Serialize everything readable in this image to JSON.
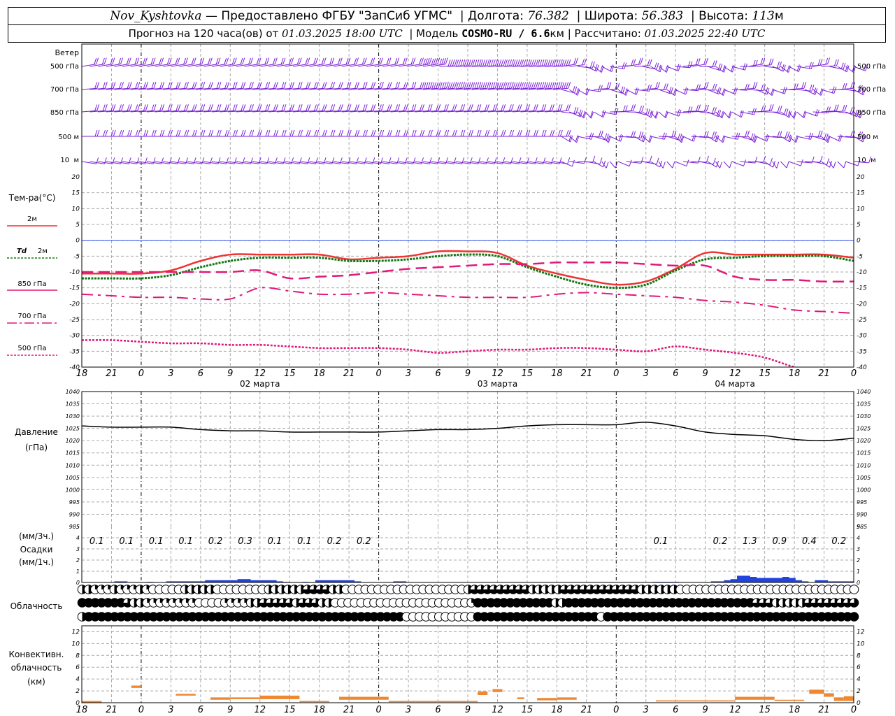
{
  "header": {
    "station": "Nov_Kyshtovka",
    "provider": "— Предоставлено ФГБУ \"ЗапСиб УГМС\"",
    "lon_label": "Долгота:",
    "lon": "76.382",
    "lat_label": "Широта:",
    "lat": "56.383",
    "alt_label": "Высота:",
    "alt": "113",
    "alt_unit": "м",
    "forecast_label": "Прогноз на 120 часа(ов) от",
    "forecast_from": "01.03.2025 18:00 UTC",
    "model_label": "| Модель",
    "model": "COSMO-RU / 6.6",
    "model_unit": "км",
    "calc_label": "| Рассчитано:",
    "calc": "01.03.2025 22:40 UTC"
  },
  "time_axis": {
    "tick_labels": [
      "18",
      "21",
      "0",
      "3",
      "6",
      "9",
      "12",
      "15",
      "18",
      "21",
      "0",
      "3",
      "6",
      "9",
      "12",
      "15",
      "18",
      "21",
      "0",
      "3",
      "6",
      "9",
      "12",
      "15",
      "18",
      "21",
      "0"
    ],
    "date_labels": [
      "02 марта",
      "03 марта",
      "04 марта"
    ],
    "hours_from_start": [
      0,
      3,
      6,
      9,
      12,
      15,
      18,
      21,
      24,
      27,
      30,
      33,
      36,
      39,
      42,
      45,
      48,
      51,
      54,
      57,
      60,
      63,
      66,
      69,
      72,
      75,
      78
    ],
    "day_boundaries_hours": [
      6,
      30,
      54
    ]
  },
  "colors": {
    "wind": "#7a1fd6",
    "t2m": "#ee3333",
    "td2m": "#117711",
    "t850": "#e0187a",
    "t700": "#e0187a",
    "t500": "#e0187a",
    "zero_line": "#3355ee",
    "pressure": "#000000",
    "precip": "#2244dd",
    "convective": "#ee8833"
  },
  "wind_panel": {
    "title": "Ветер",
    "levels": [
      "500 гПа",
      "700 гПа",
      "850 гПа",
      "500 м",
      "10  м"
    ]
  },
  "temp_legend": {
    "title": "Тем-ра(°C)",
    "t2m": "2м",
    "td_symbol": "Td",
    "td_level": "2м",
    "t850": "850 гПа",
    "t700": "700 гПа",
    "t500": "500 гПа"
  },
  "pressure_legend": {
    "title": "Давление",
    "unit": "(гПа)"
  },
  "precip_legend": {
    "unit3h": "(мм/3ч.)",
    "title": "Осадки",
    "unit1h": "(мм/1ч.)"
  },
  "cloud_legend": {
    "title": "Облачность"
  },
  "conv_legend": {
    "line1": "Конвективн.",
    "line2": "облачность",
    "unit": "(км)"
  },
  "chart_data": [
    {
      "type": "line",
      "title": "Тем-ра(°C)",
      "x_unit": "hours from 01.03.2025 18:00 UTC",
      "ylim": [
        -40,
        20
      ],
      "yticks": [
        20,
        15,
        10,
        5,
        0,
        -5,
        -10,
        -15,
        -20,
        -25,
        -30,
        -35,
        -40
      ],
      "grid": true,
      "x": [
        0,
        3,
        6,
        9,
        12,
        15,
        18,
        21,
        24,
        27,
        30,
        33,
        36,
        39,
        42,
        45,
        48,
        51,
        54,
        57,
        60,
        63,
        66,
        69,
        72,
        75,
        78
      ],
      "series": [
        {
          "name": "2м",
          "values": [
            -10.5,
            -10.5,
            -10.5,
            -9.5,
            -6.5,
            -4.5,
            -4.5,
            -4.5,
            -4.5,
            -6,
            -5.5,
            -5,
            -3.5,
            -3.5,
            -4,
            -8,
            -10.5,
            -12.5,
            -14,
            -13,
            -9,
            -4,
            -4.5,
            -4.5,
            -4.5,
            -4.5,
            -5.5
          ]
        },
        {
          "name": "Td 2м",
          "values": [
            -12,
            -12,
            -12,
            -11,
            -8.5,
            -6.5,
            -5.5,
            -5.5,
            -5.5,
            -6.5,
            -6.5,
            -6,
            -5,
            -4.5,
            -5,
            -8.5,
            -11.5,
            -14,
            -15,
            -14,
            -9.5,
            -6,
            -5.5,
            -5,
            -5,
            -5,
            -6.5
          ]
        },
        {
          "name": "850 гПа",
          "values": [
            -10,
            -10,
            -10,
            -10,
            -10,
            -10,
            -9.5,
            -12,
            -11.5,
            -11,
            -10,
            -9,
            -8.5,
            -8,
            -7.5,
            -7.5,
            -7,
            -7,
            -7,
            -7.5,
            -8,
            -8,
            -11.5,
            -12.5,
            -12.5,
            -13,
            -13
          ]
        },
        {
          "name": "700 гПа",
          "values": [
            -17,
            -17.5,
            -18,
            -18,
            -18.5,
            -18.5,
            -15,
            -16,
            -17,
            -17,
            -16.5,
            -17,
            -17.5,
            -18,
            -18,
            -18,
            -17,
            -16.5,
            -17,
            -17.5,
            -18,
            -19,
            -19.5,
            -20.5,
            -22,
            -22.5,
            -23
          ]
        },
        {
          "name": "500 гПа",
          "values": [
            -31.5,
            -31.5,
            -32,
            -32.5,
            -32.5,
            -33,
            -33,
            -33.5,
            -34,
            -34,
            -34,
            -34.5,
            -35.5,
            -35,
            -34.5,
            -34.5,
            -34,
            -34,
            -34.5,
            -35,
            -33.5,
            -34.5,
            -35.5,
            -37,
            -40,
            -42,
            -44
          ]
        }
      ]
    },
    {
      "type": "line",
      "title": "Давление",
      "ylim": [
        985,
        1040
      ],
      "yticks": [
        1040,
        1035,
        1030,
        1025,
        1020,
        1015,
        1010,
        1005,
        1000,
        995,
        990,
        985
      ],
      "grid": true,
      "x": [
        0,
        3,
        6,
        9,
        12,
        15,
        18,
        21,
        24,
        27,
        30,
        33,
        36,
        39,
        42,
        45,
        48,
        51,
        54,
        57,
        60,
        63,
        66,
        69,
        72,
        75,
        78
      ],
      "series": [
        {
          "name": "",
          "values": [
            1026,
            1025.5,
            1025.5,
            1025.5,
            1024.5,
            1024,
            1024,
            1023.5,
            1023.5,
            1023.5,
            1023.5,
            1024,
            1024.5,
            1024.5,
            1025,
            1026,
            1026.5,
            1026.5,
            1026.5,
            1027.5,
            1026,
            1023.5,
            1022.5,
            1022,
            1020.5,
            1020,
            1021
          ]
        }
      ]
    },
    {
      "type": "bar",
      "title": "Осадки",
      "ylim": [
        0,
        5
      ],
      "yticks": [
        5,
        4,
        3,
        2,
        1,
        0
      ],
      "three_hour_totals": [
        {
          "hour": 1.5,
          "label": "0.1"
        },
        {
          "hour": 4.5,
          "label": "0.1"
        },
        {
          "hour": 7.5,
          "label": "0.1"
        },
        {
          "hour": 10.5,
          "label": "0.1"
        },
        {
          "hour": 13.5,
          "label": "0.2"
        },
        {
          "hour": 16.5,
          "label": "0.3"
        },
        {
          "hour": 19.5,
          "label": "0.1"
        },
        {
          "hour": 22.5,
          "label": "0.1"
        },
        {
          "hour": 25.5,
          "label": "0.2"
        },
        {
          "hour": 28.5,
          "label": "0.2"
        },
        {
          "hour": 58.5,
          "label": "0.1"
        },
        {
          "hour": 64.5,
          "label": "0.2"
        },
        {
          "hour": 67.5,
          "label": "1.3"
        },
        {
          "hour": 70.5,
          "label": "0.9"
        },
        {
          "hour": 73.5,
          "label": "0.4"
        },
        {
          "hour": 76.5,
          "label": "0.2"
        }
      ],
      "hourly_values_mm": [
        0,
        0,
        0,
        0,
        0,
        0.1,
        0.1,
        0,
        0,
        0,
        0.05,
        0,
        0,
        0.1,
        0.1,
        0.1,
        0.1,
        0.1,
        0.1,
        0.2,
        0.2,
        0.2,
        0.2,
        0.2,
        0.3,
        0.3,
        0.2,
        0.2,
        0.2,
        0.2,
        0.1,
        0.05,
        0,
        0,
        0.05,
        0,
        0.2,
        0.2,
        0.2,
        0.2,
        0.2,
        0.2,
        0.1,
        0,
        0,
        0,
        0,
        0,
        0.1,
        0.1,
        0,
        0,
        0,
        0,
        0,
        0,
        0,
        0,
        0,
        0,
        0,
        0,
        0,
        0,
        0,
        0,
        0,
        0,
        0,
        0,
        0,
        0,
        0,
        0,
        0,
        0,
        0,
        0,
        0,
        0,
        0,
        0,
        0,
        0,
        0,
        0,
        0,
        0,
        0.05,
        0.05,
        0.05,
        0.05,
        0,
        0,
        0,
        0,
        0,
        0.1,
        0.1,
        0.2,
        0.3,
        0.6,
        0.6,
        0.5,
        0.4,
        0.4,
        0.4,
        0.4,
        0.5,
        0.4,
        0.2,
        0.1,
        0,
        0.2,
        0.2,
        0.1,
        0.1,
        0.1,
        0.1
      ]
    },
    {
      "type": "table",
      "title": "Облачность",
      "rows_eighths": {
        "high": [
          4,
          4,
          2,
          2,
          2,
          4,
          2,
          2,
          2,
          4,
          2,
          0,
          0,
          0,
          0,
          0,
          4,
          4,
          4,
          4,
          4,
          0,
          0,
          0,
          0,
          0,
          0,
          0,
          0,
          4,
          4,
          4,
          4,
          4,
          4,
          6,
          6,
          6,
          6,
          4,
          4,
          0,
          0,
          0,
          0,
          0,
          0,
          0,
          0,
          0,
          0,
          0,
          0,
          0,
          0,
          0,
          0,
          0,
          0,
          0,
          4,
          6,
          6,
          6,
          6,
          6,
          6,
          6,
          6,
          6,
          4,
          4,
          4,
          4,
          4,
          6,
          6,
          6,
          6,
          6,
          6,
          6,
          6,
          6,
          6,
          6,
          6,
          4,
          4,
          4,
          4,
          4,
          4,
          0,
          0,
          0,
          0,
          0,
          0,
          0,
          0,
          0,
          0,
          0,
          0,
          0,
          0,
          0,
          0,
          0,
          0,
          0,
          0,
          0,
          0,
          0,
          0,
          0,
          0,
          0,
          0
        ],
        "middle": [
          8,
          8,
          8,
          8,
          8,
          8,
          8,
          6,
          4,
          4,
          2,
          2,
          2,
          2,
          2,
          2,
          2,
          2,
          0,
          0,
          0,
          0,
          2,
          2,
          2,
          2,
          4,
          4,
          6,
          6,
          6,
          6,
          6,
          4,
          6,
          6,
          6,
          4,
          4,
          0,
          0,
          0,
          0,
          0,
          0,
          0,
          0,
          0,
          0,
          0,
          0,
          0,
          0,
          0,
          0,
          0,
          0,
          0,
          0,
          0,
          2,
          8,
          8,
          8,
          8,
          8,
          8,
          8,
          8,
          8,
          8,
          8,
          8,
          4,
          4,
          8,
          8,
          8,
          8,
          8,
          8,
          8,
          8,
          8,
          8,
          8,
          8,
          8,
          8,
          8,
          8,
          8,
          8,
          8,
          8,
          8,
          8,
          8,
          8,
          8,
          8,
          8,
          8,
          8,
          6,
          6,
          6,
          4,
          4,
          4,
          4,
          4,
          6,
          6,
          6,
          6,
          6,
          6,
          6,
          6
        ],
        "low": [
          4,
          8,
          8,
          8,
          8,
          8,
          8,
          8,
          8,
          8,
          8,
          8,
          8,
          8,
          8,
          8,
          8,
          8,
          8,
          8,
          8,
          8,
          8,
          8,
          8,
          8,
          8,
          8,
          8,
          8,
          8,
          8,
          8,
          8,
          8,
          8,
          8,
          8,
          8,
          8,
          8,
          8,
          8,
          8,
          8,
          8,
          8,
          8,
          8,
          8,
          0,
          0,
          0,
          0,
          0,
          0,
          0,
          0,
          0,
          0,
          0,
          8,
          8,
          8,
          8,
          8,
          8,
          8,
          8,
          8,
          8,
          8,
          8,
          8,
          8,
          8,
          8,
          8,
          8,
          8,
          0,
          8,
          8,
          8,
          8,
          8,
          8,
          8,
          8,
          8,
          8,
          8,
          8,
          8,
          8,
          8,
          8,
          8,
          8,
          8,
          8,
          8,
          8,
          8,
          8,
          8,
          8,
          8,
          8,
          8,
          8,
          8,
          8,
          8,
          8,
          8,
          8,
          8,
          8,
          8
        ]
      }
    },
    {
      "type": "bar",
      "title": "Конвективн. облачность",
      "ylim": [
        0,
        13
      ],
      "yticks": [
        12,
        10,
        8,
        6,
        4,
        2,
        0
      ],
      "segments": [
        {
          "from": 0,
          "to": 2,
          "base": 0,
          "top": 0.3
        },
        {
          "from": 5,
          "to": 6,
          "base": 2.5,
          "top": 2.9
        },
        {
          "from": 9.5,
          "to": 11.5,
          "base": 1.2,
          "top": 1.5
        },
        {
          "from": 13,
          "to": 15,
          "base": 0.5,
          "top": 0.9
        },
        {
          "from": 15,
          "to": 18,
          "base": 0.6,
          "top": 0.9
        },
        {
          "from": 18,
          "to": 22,
          "base": 0.6,
          "top": 1.2
        },
        {
          "from": 22,
          "to": 25,
          "base": 0.1,
          "top": 0.3
        },
        {
          "from": 26,
          "to": 31,
          "base": 0.5,
          "top": 1
        },
        {
          "from": 31,
          "to": 36,
          "base": 0.1,
          "top": 0.3
        },
        {
          "from": 36,
          "to": 40,
          "base": 0.1,
          "top": 0.3
        },
        {
          "from": 40,
          "to": 41,
          "base": 1.3,
          "top": 1.9
        },
        {
          "from": 41.5,
          "to": 42.5,
          "base": 1.8,
          "top": 2.3
        },
        {
          "from": 44,
          "to": 44.7,
          "base": 0.6,
          "top": 0.9
        },
        {
          "from": 46,
          "to": 48,
          "base": 0.4,
          "top": 0.8
        },
        {
          "from": 48,
          "to": 50,
          "base": 0.5,
          "top": 0.9
        },
        {
          "from": 73.5,
          "to": 75,
          "base": 1.5,
          "top": 2.2
        },
        {
          "from": 75,
          "to": 76,
          "base": 1,
          "top": 1.6
        },
        {
          "from": 76,
          "to": 77,
          "base": 0.3,
          "top": 0.9
        },
        {
          "from": 77,
          "to": 78,
          "base": 0.3,
          "top": 1.1
        },
        {
          "from": 58,
          "to": 66,
          "base": 0.2,
          "top": 0.4
        },
        {
          "from": 66,
          "to": 70,
          "base": 0.5,
          "top": 1
        },
        {
          "from": 70,
          "to": 73,
          "base": 0.3,
          "top": 0.5
        }
      ]
    }
  ]
}
